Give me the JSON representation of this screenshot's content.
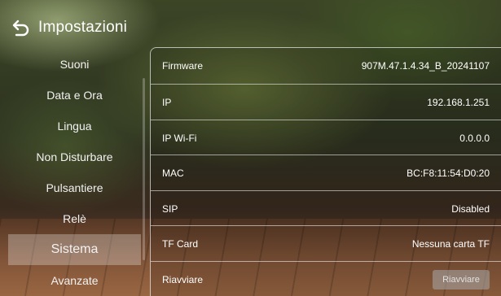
{
  "header": {
    "title": "Impostazioni",
    "back_icon": "back-arrow-icon"
  },
  "sidebar": {
    "items": [
      {
        "label": "Suoni"
      },
      {
        "label": "Data e Ora"
      },
      {
        "label": "Lingua"
      },
      {
        "label": "Non Disturbare"
      },
      {
        "label": "Pulsantiere"
      },
      {
        "label": "Relè"
      },
      {
        "label": "Sistema",
        "active": true
      },
      {
        "label": "Avanzate"
      }
    ]
  },
  "info": {
    "firmware": {
      "label": "Firmware",
      "value": "907M.47.1.4.34_B_20241107"
    },
    "ip": {
      "label": "IP",
      "value": "192.168.1.251"
    },
    "ip_wifi": {
      "label": "IP Wi-Fi",
      "value": "0.0.0.0"
    },
    "mac": {
      "label": "MAC",
      "value": "BC:F8:11:54:D0:20"
    },
    "sip": {
      "label": "SIP",
      "value": "Disabled"
    },
    "tf_card": {
      "label": "TF Card",
      "value": "Nessuna carta TF"
    },
    "reboot": {
      "label": "Riavviare",
      "button": "Riavviare"
    }
  },
  "colors": {
    "active_item_bg": "#ffffff47",
    "divider": "#ffffff8c"
  }
}
